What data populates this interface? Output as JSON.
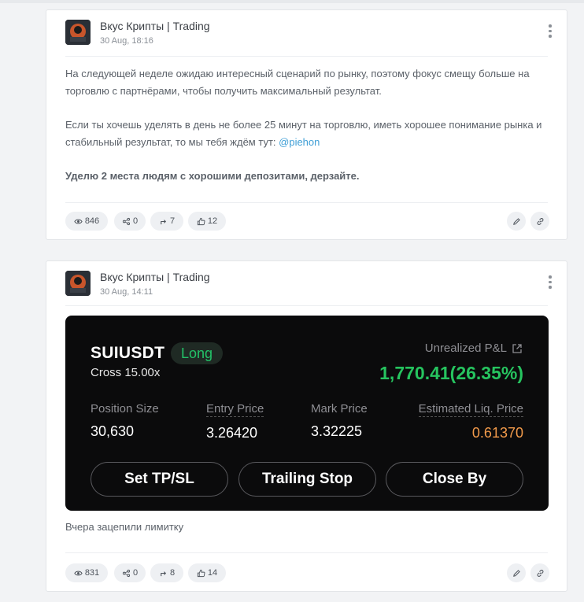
{
  "posts": [
    {
      "author": "Вкус Крипты | Trading",
      "date": "30 Aug, 18:16",
      "paragraph1": "На следующей неделе ожидаю интересный сценарий по рынку, поэтому фокус смещу больше на торговлю с партнёрами, чтобы получить максимальный результат.",
      "paragraph2": "Если ты хочешь уделять в день не более 25 минут на торговлю, иметь хорошее понимание рынка и стабильный результат, то мы тебя ждём тут:",
      "mention": "@piehon",
      "paragraph3": "Уделю 2 места людям с хорошими депозитами, дерзайте.",
      "views": "846",
      "shares": "0",
      "forwards": "7",
      "likes": "12"
    },
    {
      "author": "Вкус Крипты | Trading",
      "date": "30 Aug, 14:11",
      "caption": "Вчера зацепили лимитку",
      "views": "831",
      "shares": "0",
      "forwards": "8",
      "likes": "14"
    }
  ],
  "trade": {
    "symbol": "SUIUSDT",
    "side": "Long",
    "margin_mode": "Cross 15.00x",
    "pnl_label": "Unrealized P&L",
    "pnl_value": "1,770.41(26.35%)",
    "position_size_label": "Position Size",
    "position_size": "30,630",
    "entry_price_label": "Entry Price",
    "entry_price": "3.26420",
    "mark_price_label": "Mark Price",
    "mark_price": "3.32225",
    "liq_price_label": "Estimated Liq. Price",
    "liq_price": "0.61370",
    "buttons": [
      "Set TP/SL",
      "Trailing Stop",
      "Close By"
    ]
  },
  "colors": {
    "long_green": "#23c268",
    "pnl_green": "#26c45f",
    "liq_orange": "#f39b4b",
    "mention_blue": "#3f9fd6"
  },
  "icons": [
    "eye-icon",
    "share-icon",
    "forward-icon",
    "thumbs-up-icon",
    "edit-icon",
    "link-icon",
    "more-vertical-icon",
    "external-link-icon"
  ]
}
